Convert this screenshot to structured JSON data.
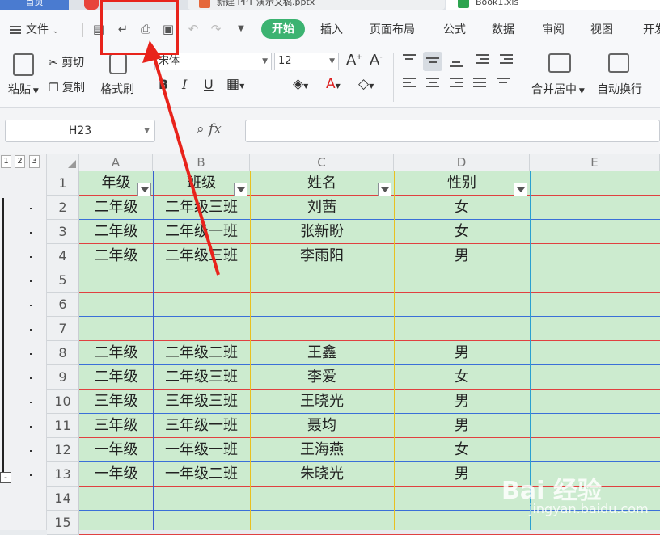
{
  "tabs": {
    "home": "首页",
    "ppt": "新建 PPT 演示文稿.pptx",
    "xls": "Book1.xls"
  },
  "menu": {
    "file": "文件",
    "start": "开始",
    "insert": "插入",
    "layout": "页面布局",
    "formula": "公式",
    "data": "数据",
    "review": "审阅",
    "view": "视图",
    "dev": "开发"
  },
  "ribbon": {
    "paste": "粘贴",
    "cut": "剪切",
    "copy": "复制",
    "format_painter": "格式刷",
    "font": "宋体",
    "font_size": "12",
    "bold": "B",
    "italic": "I",
    "underline": "U",
    "merge": "合并居中",
    "wrap": "自动换行"
  },
  "formula_bar": {
    "cell_ref": "H23",
    "fx": "fx",
    "value": ""
  },
  "outline_levels": [
    "1",
    "2",
    "3"
  ],
  "columns": [
    "A",
    "B",
    "C",
    "D",
    "E"
  ],
  "rows": [
    {
      "n": "1",
      "cells": [
        "年级",
        "班级",
        "姓名",
        "性别"
      ]
    },
    {
      "n": "2",
      "cells": [
        "二年级",
        "二年级三班",
        "刘茜",
        "女"
      ]
    },
    {
      "n": "3",
      "cells": [
        "二年级",
        "二年级一班",
        "张新盼",
        "女"
      ]
    },
    {
      "n": "4",
      "cells": [
        "二年级",
        "二年级三班",
        "李雨阳",
        "男"
      ]
    },
    {
      "n": "5",
      "cells": [
        "",
        "",
        "",
        ""
      ]
    },
    {
      "n": "6",
      "cells": [
        "",
        "",
        "",
        ""
      ]
    },
    {
      "n": "7",
      "cells": [
        "",
        "",
        "",
        ""
      ]
    },
    {
      "n": "8",
      "cells": [
        "二年级",
        "二年级二班",
        "王鑫",
        "男"
      ]
    },
    {
      "n": "9",
      "cells": [
        "二年级",
        "二年级三班",
        "李爱",
        "女"
      ]
    },
    {
      "n": "10",
      "cells": [
        "三年级",
        "三年级三班",
        "王晓光",
        "男"
      ]
    },
    {
      "n": "11",
      "cells": [
        "三年级",
        "三年级一班",
        "聂均",
        "男"
      ]
    },
    {
      "n": "12",
      "cells": [
        "一年级",
        "一年级一班",
        "王海燕",
        "女"
      ]
    },
    {
      "n": "13",
      "cells": [
        "一年级",
        "一年级二班",
        "朱晓光",
        "男"
      ]
    },
    {
      "n": "14",
      "cells": [
        "",
        "",
        "",
        ""
      ]
    },
    {
      "n": "15",
      "cells": [
        "",
        "",
        "",
        ""
      ]
    }
  ],
  "watermark": {
    "main": "Bai 经验",
    "sub": "jingyan.baidu.com"
  },
  "colors": {
    "accent": "#3cb371",
    "sheet_bg": "#ccebcf",
    "highlight": "#e8231b"
  }
}
